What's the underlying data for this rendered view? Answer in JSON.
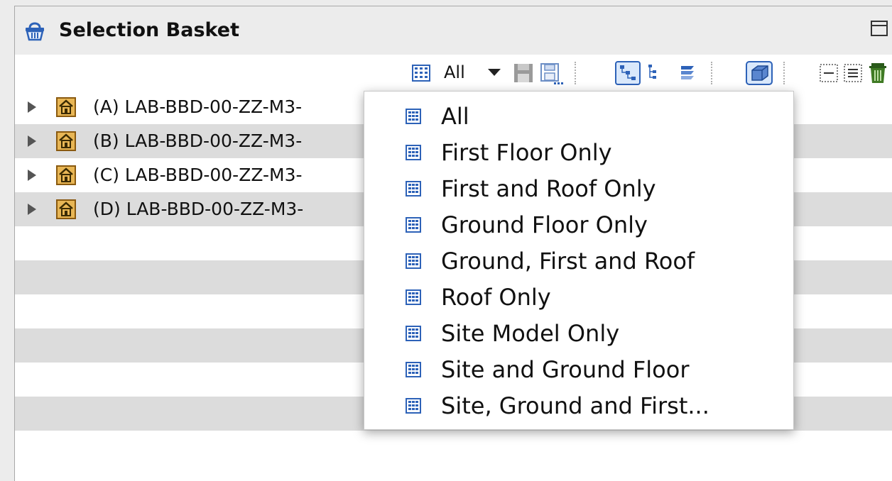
{
  "panel": {
    "title": "Selection Basket"
  },
  "toolbar": {
    "filter_label": "All",
    "icons": [
      "grid-icon",
      "caret-down-icon",
      "save-icon",
      "save-as-icon",
      "tree-view-icon",
      "flat-list-icon",
      "layers-icon",
      "3d-box-icon",
      "collapse-icon",
      "expand-icon",
      "trash-icon"
    ]
  },
  "rows": [
    {
      "label": "(A) LAB-BBD-00-ZZ-M3-"
    },
    {
      "label": "(B) LAB-BBD-00-ZZ-M3-"
    },
    {
      "label": "(C) LAB-BBD-00-ZZ-M3-"
    },
    {
      "label": "(D) LAB-BBD-00-ZZ-M3-"
    }
  ],
  "dropdown": {
    "items": [
      {
        "label": "All"
      },
      {
        "label": "First Floor Only"
      },
      {
        "label": "First and Roof Only"
      },
      {
        "label": "Ground Floor Only"
      },
      {
        "label": "Ground, First and Roof"
      },
      {
        "label": "Roof Only"
      },
      {
        "label": "Site Model Only"
      },
      {
        "label": "Site and Ground Floor"
      },
      {
        "label": "Site, Ground and First..."
      }
    ]
  },
  "colors": {
    "accent_blue": "#2d62b8",
    "building_orange": "#d9a441",
    "row_alt": "#dcdcdc"
  }
}
